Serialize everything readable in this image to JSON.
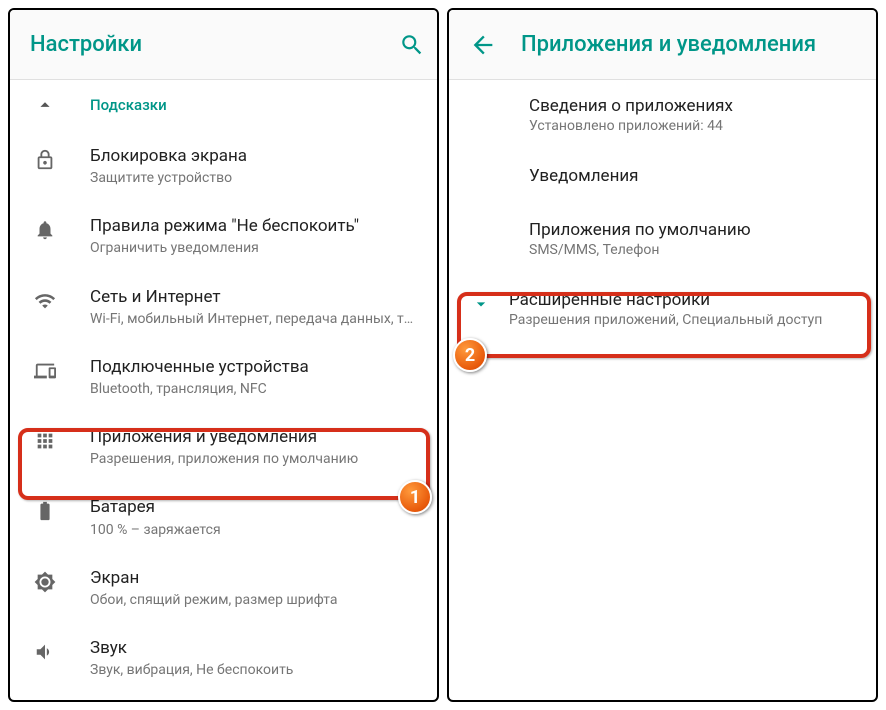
{
  "left": {
    "title": "Настройки",
    "hints_label": "Подсказки",
    "items": [
      {
        "icon": "lock",
        "title": "Блокировка экрана",
        "subtitle": "Защитите устройство"
      },
      {
        "icon": "bell",
        "title": "Правила режима \"Не беспокоить\"",
        "subtitle": "Ограничить уведомления"
      },
      {
        "icon": "wifi",
        "title": "Сеть и Интернет",
        "subtitle": "Wi-Fi, мобильный Интернет, передача данных, т…"
      },
      {
        "icon": "devices",
        "title": "Подключенные устройства",
        "subtitle": "Bluetooth, трансляция, NFC"
      },
      {
        "icon": "apps",
        "title": "Приложения и уведомления",
        "subtitle": "Разрешения, приложения по умолчанию"
      },
      {
        "icon": "battery",
        "title": "Батарея",
        "subtitle": "100 % – заряжается"
      },
      {
        "icon": "brightness",
        "title": "Экран",
        "subtitle": "Обои, спящий режим, размер шрифта"
      },
      {
        "icon": "volume",
        "title": "Звук",
        "subtitle": "Звук, вибрация, Не беспокоить"
      }
    ]
  },
  "right": {
    "title": "Приложения и уведомления",
    "items": [
      {
        "title": "Сведения о приложениях",
        "subtitle": "Установлено приложений: 44"
      },
      {
        "title": "Уведомления",
        "subtitle": ""
      },
      {
        "title": "Приложения по умолчанию",
        "subtitle": "SMS/MMS, Телефон"
      }
    ],
    "advanced": {
      "title": "Расширенные настройки",
      "subtitle": "Разрешения приложений, Специальный доступ"
    }
  },
  "badges": {
    "one": "1",
    "two": "2"
  }
}
